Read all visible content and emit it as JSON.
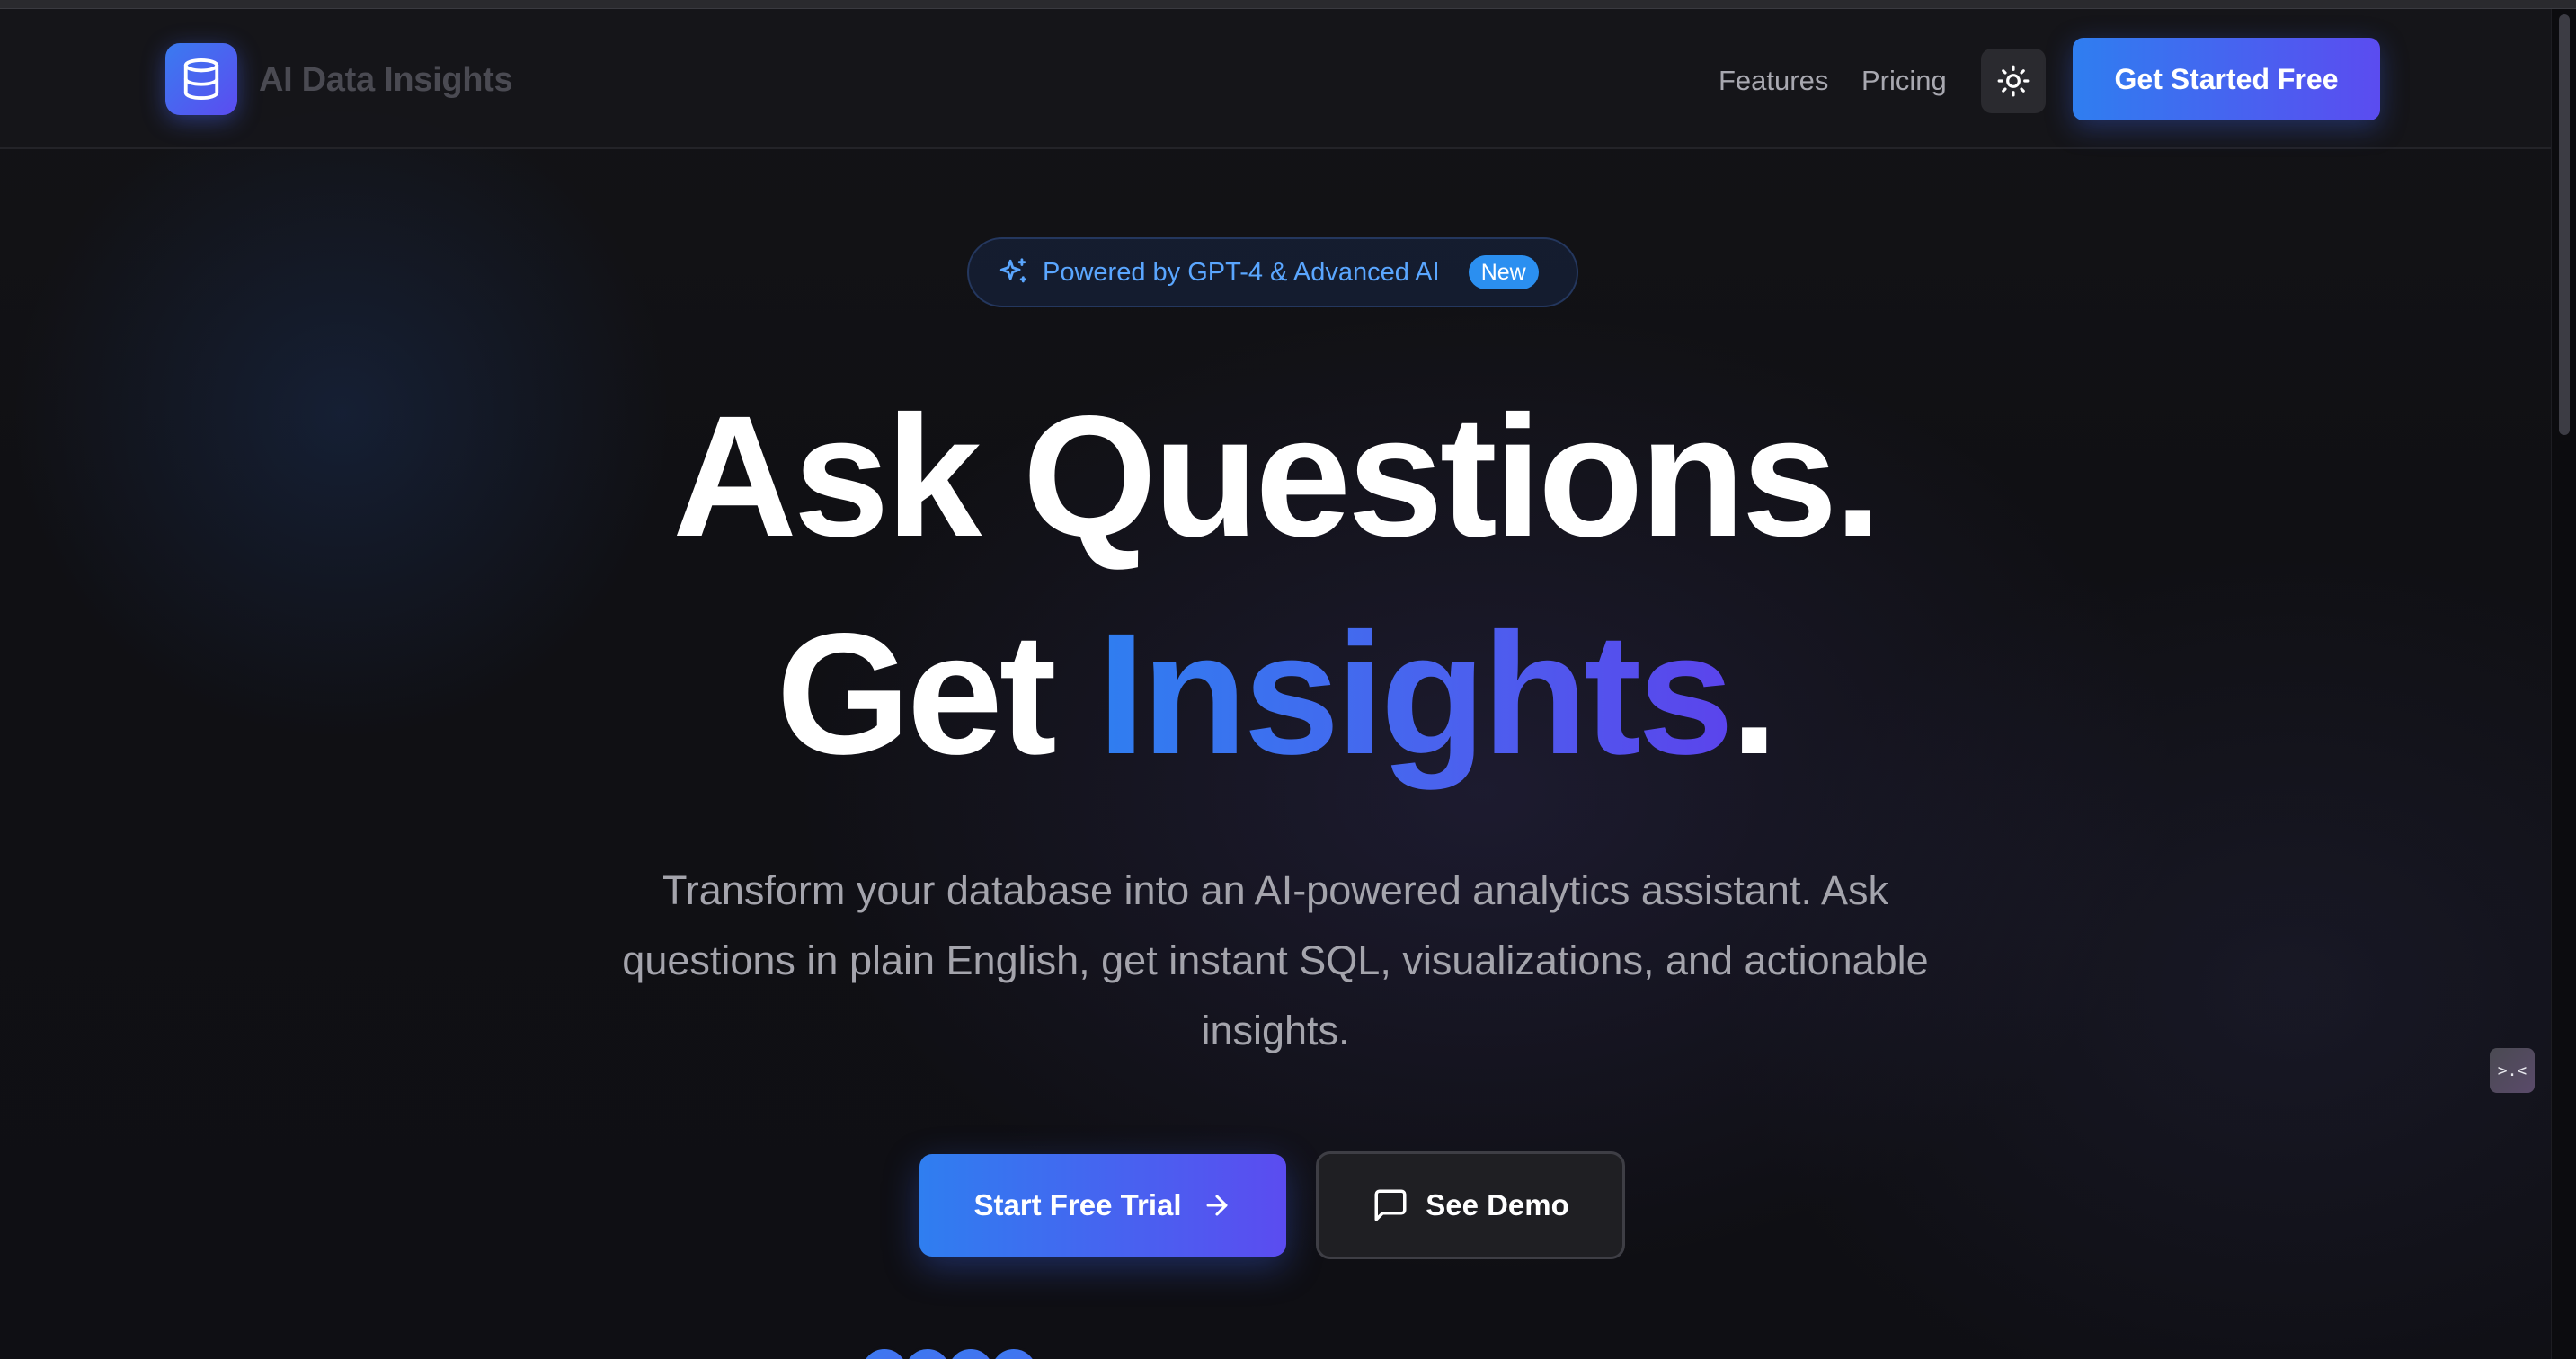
{
  "header": {
    "logo_text": "AI Data Insights",
    "nav": [
      {
        "label": "Features"
      },
      {
        "label": "Pricing"
      }
    ],
    "theme_toggle_icon": "sun-icon",
    "cta_label": "Get Started Free"
  },
  "badge": {
    "icon": "sparkles-icon",
    "text": "Powered by GPT-4 & Advanced AI",
    "tag": "New"
  },
  "hero": {
    "line1": "Ask Questions.",
    "line2_prefix": "Get ",
    "line2_highlight": "Insights",
    "line2_suffix": "."
  },
  "subtitle": "Transform your database into an AI-powered analytics assistant. Ask questions in plain English, get instant SQL, visualizations, and actionable insights.",
  "buttons": {
    "primary_label": "Start Free Trial",
    "primary_icon": "arrow-right-icon",
    "secondary_label": "See Demo",
    "secondary_icon": "message-square-icon"
  },
  "floating_widget": {
    "icon": "face-icon",
    "text": ">.<"
  },
  "colors": {
    "accent_start": "#2f7ef0",
    "accent_end": "#5b4cf0",
    "badge_text": "#5aa6ff",
    "background": "#0f0f14"
  }
}
